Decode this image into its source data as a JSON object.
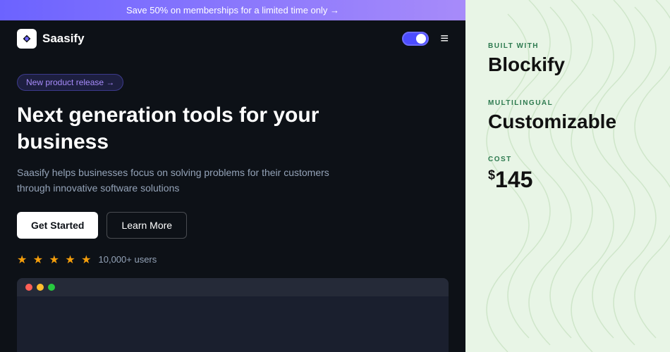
{
  "banner": {
    "text": "Save 50% on memberships for a limited time only →"
  },
  "navbar": {
    "logo_text": "Saasify",
    "toggle_aria": "dark mode toggle",
    "menu_aria": "menu"
  },
  "badge": {
    "label": "New product release →"
  },
  "hero": {
    "title": "Next generation tools for your business",
    "subtitle": "Saasify helps businesses focus on solving problems for their customers through innovative software solutions",
    "cta_primary": "Get Started",
    "cta_secondary": "Learn More"
  },
  "social_proof": {
    "stars": "★ ★ ★ ★ ★",
    "users": "10,000+ users"
  },
  "browser": {
    "dot_red": "red",
    "dot_yellow": "yellow",
    "dot_green": "green"
  },
  "right_panel": {
    "built_with_label": "BUILT WITH",
    "built_with_value": "Blockify",
    "multilingual_label": "MULTILINGUAL",
    "multilingual_value": "Customizable",
    "cost_label": "COST",
    "cost_currency": "$",
    "cost_value": "145"
  }
}
